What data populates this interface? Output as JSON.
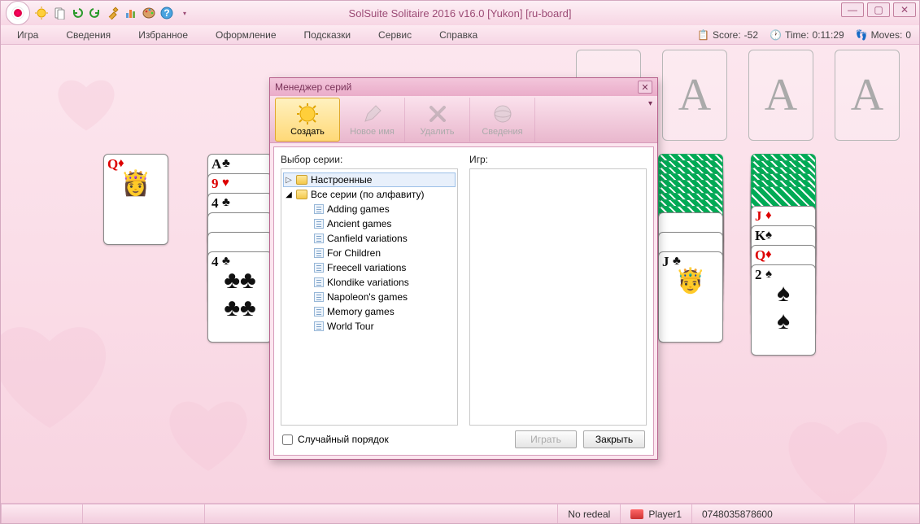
{
  "titlebar": {
    "title": "SolSuite Solitaire 2016 v16.0  [Yukon]  [ru-board]"
  },
  "menubar": {
    "items": [
      "Игра",
      "Сведения",
      "Избранное",
      "Оформление",
      "Подсказки",
      "Сервис",
      "Справка"
    ],
    "score_label": "Score:",
    "score_value": "-52",
    "time_label": "Time:",
    "time_value": "0:11:29",
    "moves_label": "Moves:",
    "moves_value": "0"
  },
  "foundations": {
    "placeholder": "A"
  },
  "columns": {
    "c1": {
      "top": "Q",
      "suit": "♦"
    },
    "c2": [
      {
        "r": "A",
        "s": "♣",
        "c": "black"
      },
      {
        "r": "9",
        "s": "♥",
        "c": "red"
      },
      {
        "r": "4",
        "s": "♣",
        "c": "black"
      },
      {
        "r": "",
        "s": "",
        "c": "black"
      },
      {
        "r": "",
        "s": "",
        "c": "black"
      },
      {
        "r": "4",
        "s": "♣",
        "c": "black"
      }
    ],
    "c6": [
      {
        "r": "J",
        "s": "♣",
        "c": "black"
      }
    ],
    "c7": [
      {
        "r": "J",
        "s": "♦",
        "c": "red"
      },
      {
        "r": "K",
        "s": "♠",
        "c": "black"
      },
      {
        "r": "Q",
        "s": "♦",
        "c": "red"
      },
      {
        "r": "2",
        "s": "♠",
        "c": "black"
      }
    ]
  },
  "dialog": {
    "title": "Менеджер серий",
    "toolbar": {
      "create": "Создать",
      "rename": "Новое имя",
      "delete": "Удалить",
      "info": "Сведения"
    },
    "left_label": "Выбор серии:",
    "right_label": "Игр:",
    "tree": {
      "builtin": "Настроенные",
      "all": "Все серии (по алфавиту)",
      "children": [
        "Adding games",
        "Ancient games",
        "Canfield variations",
        "For Children",
        "Freecell variations",
        "Klondike variations",
        "Napoleon's games",
        "Memory games",
        "World Tour"
      ]
    },
    "random_checkbox": "Случайный порядок",
    "play_btn": "Играть",
    "close_btn": "Закрыть"
  },
  "statusbar": {
    "redeal": "No redeal",
    "player": "Player1",
    "number": "0748035878600"
  }
}
